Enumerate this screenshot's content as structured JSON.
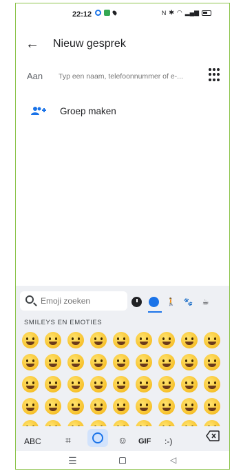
{
  "status_bar": {
    "time": "22:12",
    "right_icons": [
      "nfc-icon",
      "bluetooth-icon",
      "wifi-icon",
      "signal-icon",
      "battery-icon"
    ]
  },
  "header": {
    "title": "Nieuw gesprek",
    "back_icon": "arrow-left-icon"
  },
  "to_field": {
    "label": "Aan",
    "placeholder": "Typ een naam, telefoonnummer of e-...",
    "dialpad_icon": "dialpad-icon"
  },
  "create_group": {
    "label": "Groep maken",
    "icon": "group-add-icon"
  },
  "keyboard": {
    "search_placeholder": "Emoji zoeken",
    "categories": [
      "recent-icon",
      "smileys-icon",
      "people-icon",
      "animals-icon",
      "food-icon"
    ],
    "selected_category": "smileys-icon",
    "section_label": "SMILEYS EN EMOTIES",
    "toolbar": {
      "abc": "ABC",
      "gif": "GIF",
      "emoticon": ":-)",
      "backspace_icon": "backspace-icon"
    }
  },
  "nav_bar": {
    "icons": [
      "recents-icon",
      "home-icon",
      "back-icon"
    ]
  }
}
